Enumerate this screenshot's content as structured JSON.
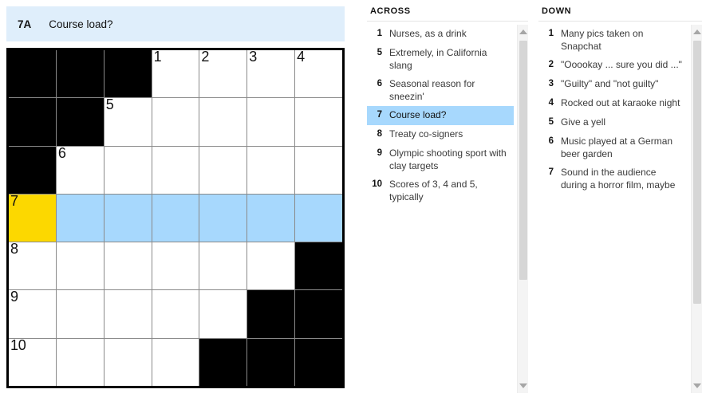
{
  "clue_bar": {
    "label": "7A",
    "text": "Course load?"
  },
  "colors": {
    "active_cell": "#FCD800",
    "highlight": "#A7D8FD",
    "clue_bar_bg": "#DFEEFB",
    "block": "#000000",
    "grid_line": "#8A8A8A"
  },
  "grid": {
    "rows": 7,
    "cols": 7,
    "cells": [
      [
        {
          "type": "block"
        },
        {
          "type": "block"
        },
        {
          "type": "block"
        },
        {
          "type": "open",
          "number": "1"
        },
        {
          "type": "open",
          "number": "2"
        },
        {
          "type": "open",
          "number": "3"
        },
        {
          "type": "open",
          "number": "4"
        }
      ],
      [
        {
          "type": "block"
        },
        {
          "type": "block"
        },
        {
          "type": "open",
          "number": "5"
        },
        {
          "type": "open"
        },
        {
          "type": "open"
        },
        {
          "type": "open"
        },
        {
          "type": "open"
        }
      ],
      [
        {
          "type": "block"
        },
        {
          "type": "open",
          "number": "6"
        },
        {
          "type": "open"
        },
        {
          "type": "open"
        },
        {
          "type": "open"
        },
        {
          "type": "open"
        },
        {
          "type": "open"
        }
      ],
      [
        {
          "type": "open",
          "number": "7",
          "state": "active"
        },
        {
          "type": "open",
          "state": "highlight"
        },
        {
          "type": "open",
          "state": "highlight"
        },
        {
          "type": "open",
          "state": "highlight"
        },
        {
          "type": "open",
          "state": "highlight"
        },
        {
          "type": "open",
          "state": "highlight"
        },
        {
          "type": "open",
          "state": "highlight"
        }
      ],
      [
        {
          "type": "open",
          "number": "8"
        },
        {
          "type": "open"
        },
        {
          "type": "open"
        },
        {
          "type": "open"
        },
        {
          "type": "open"
        },
        {
          "type": "open"
        },
        {
          "type": "block"
        }
      ],
      [
        {
          "type": "open",
          "number": "9"
        },
        {
          "type": "open"
        },
        {
          "type": "open"
        },
        {
          "type": "open"
        },
        {
          "type": "open"
        },
        {
          "type": "block"
        },
        {
          "type": "block"
        }
      ],
      [
        {
          "type": "open",
          "number": "10"
        },
        {
          "type": "open"
        },
        {
          "type": "open"
        },
        {
          "type": "open"
        },
        {
          "type": "block"
        },
        {
          "type": "block"
        },
        {
          "type": "block"
        }
      ]
    ]
  },
  "across": {
    "title": "ACROSS",
    "clues": [
      {
        "number": "1",
        "text": "Nurses, as a drink",
        "state": "normal"
      },
      {
        "number": "5",
        "text": "Extremely, in California slang",
        "state": "normal"
      },
      {
        "number": "6",
        "text": "Seasonal reason for sneezin'",
        "state": "normal"
      },
      {
        "number": "7",
        "text": "Course load?",
        "state": "selected"
      },
      {
        "number": "8",
        "text": "Treaty co-signers",
        "state": "normal"
      },
      {
        "number": "9",
        "text": "Olympic shooting sport with clay targets",
        "state": "normal"
      },
      {
        "number": "10",
        "text": "Scores of 3, 4 and 5, typically",
        "state": "normal"
      }
    ]
  },
  "down": {
    "title": "DOWN",
    "clues": [
      {
        "number": "1",
        "text": "Many pics taken on Snapchat",
        "state": "normal"
      },
      {
        "number": "2",
        "text": "\"Ooookay ... sure you did ...\"",
        "state": "normal"
      },
      {
        "number": "3",
        "text": "\"Guilty\" and \"not guilty\"",
        "state": "normal"
      },
      {
        "number": "4",
        "text": "Rocked out at karaoke night",
        "state": "normal"
      },
      {
        "number": "5",
        "text": "Give a yell",
        "state": "normal"
      },
      {
        "number": "6",
        "text": "Music played at a German beer garden",
        "state": "normal"
      },
      {
        "number": "7",
        "text": "Sound in the audience during a horror film, maybe",
        "state": "crossed"
      }
    ]
  },
  "scrollbars": {
    "across": {
      "up_icon": "triangle-up-icon",
      "down_icon": "triangle-down-icon"
    },
    "down": {
      "up_icon": "triangle-up-icon",
      "down_icon": "triangle-down-icon"
    }
  }
}
